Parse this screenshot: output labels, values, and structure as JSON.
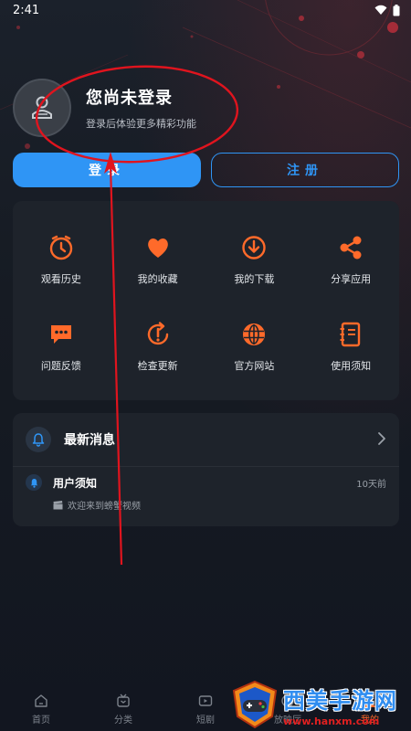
{
  "status_bar": {
    "time": "2:41"
  },
  "profile": {
    "title": "您尚未登录",
    "subtitle": "登录后体验更多精彩功能"
  },
  "buttons": {
    "login": "登录",
    "register": "注册"
  },
  "grid": {
    "items": [
      {
        "label": "观看历史",
        "icon": "clock-icon"
      },
      {
        "label": "我的收藏",
        "icon": "heart-icon"
      },
      {
        "label": "我的下载",
        "icon": "download-icon"
      },
      {
        "label": "分享应用",
        "icon": "share-icon"
      },
      {
        "label": "问题反馈",
        "icon": "chat-icon"
      },
      {
        "label": "检查更新",
        "icon": "update-icon"
      },
      {
        "label": "官方网站",
        "icon": "globe-icon"
      },
      {
        "label": "使用须知",
        "icon": "notebook-icon"
      }
    ]
  },
  "messages": {
    "header": "最新消息",
    "items": [
      {
        "title": "用户须知",
        "time": "10天前",
        "body": "欢迎来到螃蟹视频"
      }
    ]
  },
  "tabbar": {
    "tabs": [
      {
        "label": "首页",
        "icon": "home-icon",
        "active": false
      },
      {
        "label": "分类",
        "icon": "category-icon",
        "active": false
      },
      {
        "label": "短剧",
        "icon": "shortplay-icon",
        "active": false
      },
      {
        "label": "放映厅",
        "icon": "theater-icon",
        "active": false
      },
      {
        "label": "我的",
        "icon": "profile-icon",
        "active": true
      }
    ]
  },
  "watermark": {
    "title": "西美手游网",
    "url": "www.hanxm.com"
  },
  "colors": {
    "accent_blue": "#2f95f5",
    "accent_orange": "#ff6a2a",
    "annotation_red": "#e0141e",
    "background": "#141820",
    "card": "#1e232b"
  }
}
